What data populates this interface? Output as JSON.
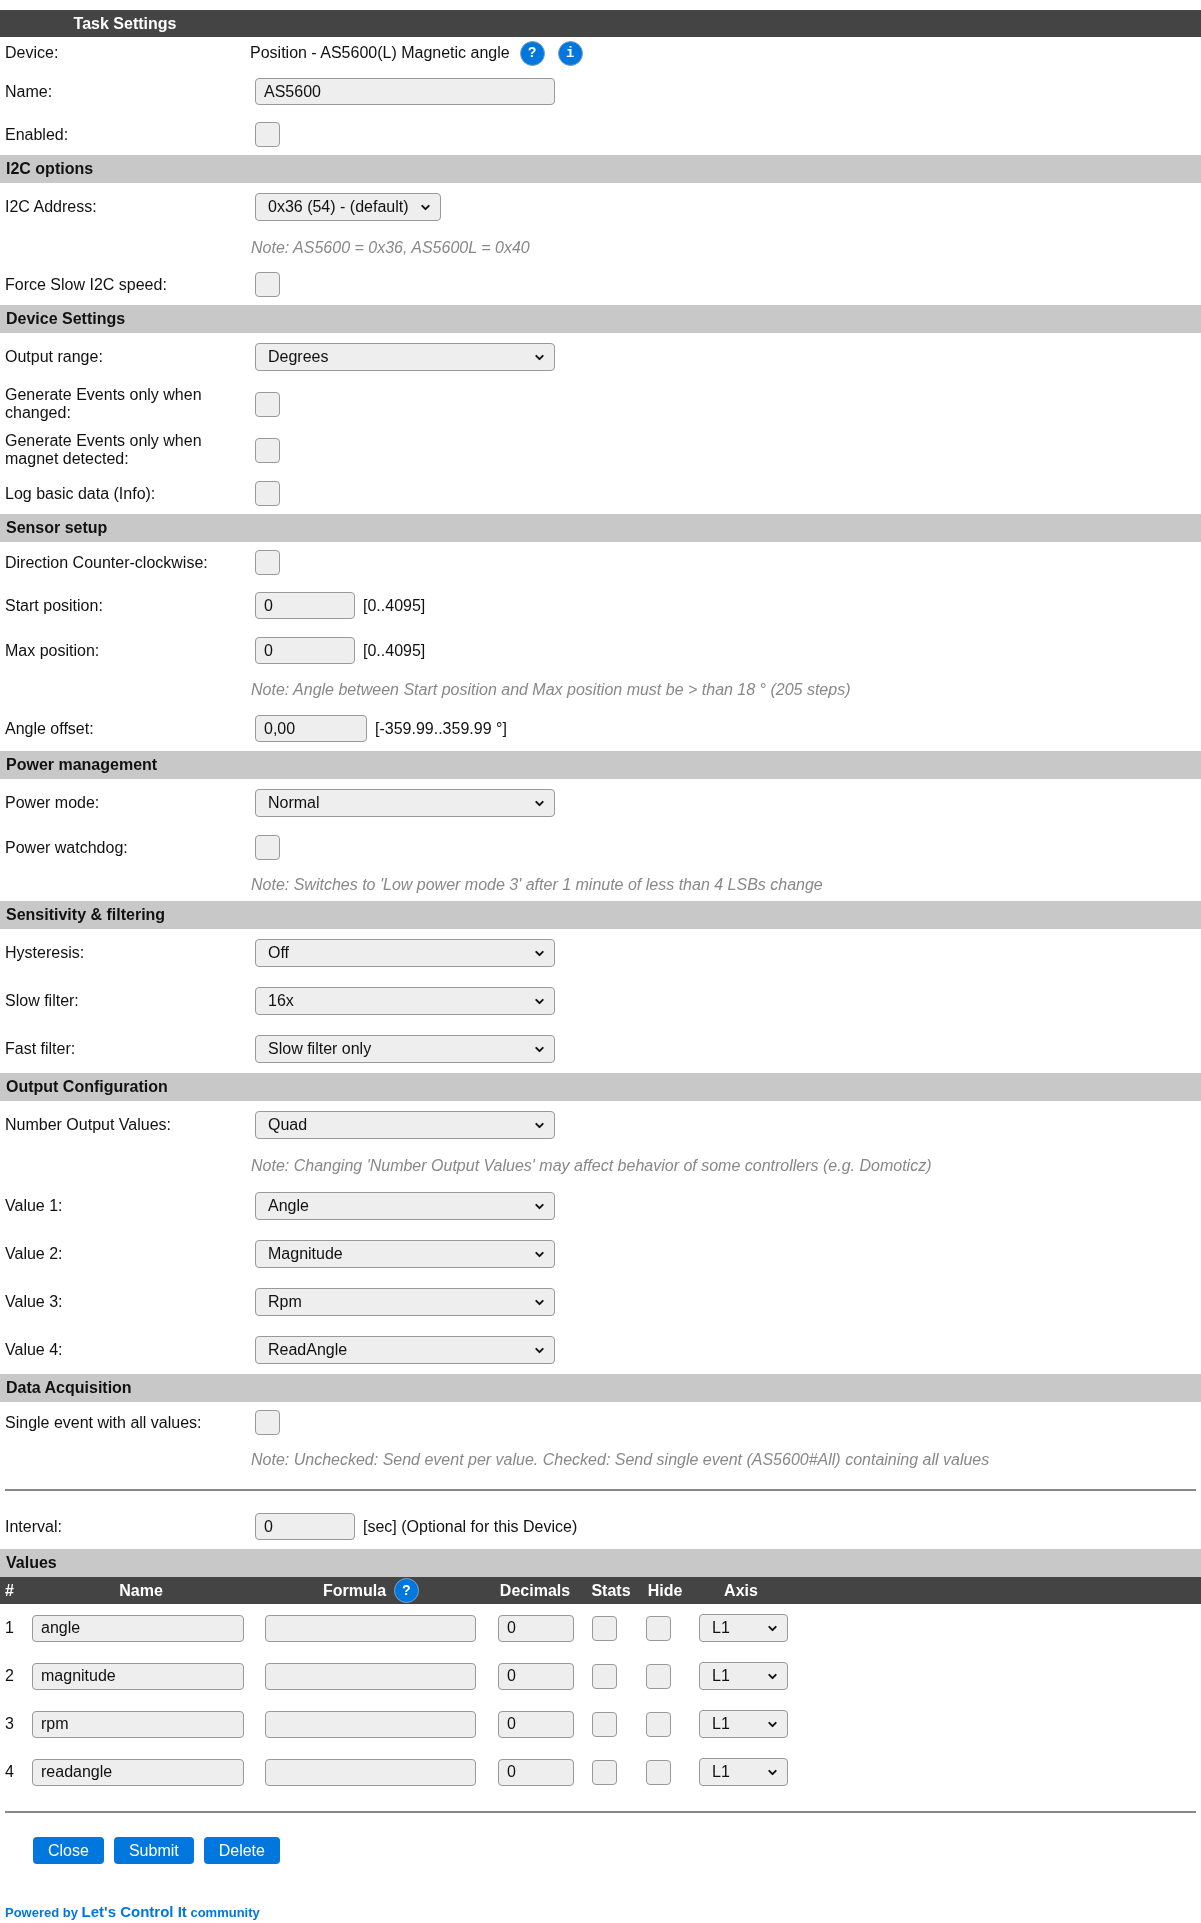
{
  "title": "Task Settings",
  "general": [
    {
      "kind": "device",
      "label": "Device:",
      "value": "Position - AS5600(L) Magnetic angle",
      "help": "?",
      "info": "i"
    },
    {
      "kind": "text",
      "label": "Name:",
      "value": "AS5600"
    },
    {
      "kind": "checkbox",
      "label": "Enabled:",
      "checked": false
    }
  ],
  "sections": [
    {
      "heading": "I2C options",
      "rows": [
        {
          "kind": "select_short",
          "label": "I2C Address:",
          "value": "0x36 (54) - (default)"
        },
        {
          "kind": "note",
          "text": "Note: AS5600 = 0x36, AS5600L = 0x40"
        },
        {
          "kind": "checkbox",
          "label": "Force Slow I2C speed:",
          "checked": false
        }
      ]
    },
    {
      "heading": "Device Settings",
      "rows": [
        {
          "kind": "select",
          "label": "Output range:",
          "value": "Degrees"
        },
        {
          "kind": "checkbox",
          "label": "Generate Events only when changed:",
          "checked": false
        },
        {
          "kind": "checkbox",
          "label": "Generate Events only when magnet detected:",
          "checked": false
        },
        {
          "kind": "checkbox",
          "label": "Log basic data (Info):",
          "checked": false
        }
      ]
    },
    {
      "heading": "Sensor setup",
      "rows": [
        {
          "kind": "checkbox",
          "label": "Direction Counter-clockwise:",
          "checked": false
        },
        {
          "kind": "number",
          "label": "Start position:",
          "value": "0",
          "hint": "[0..4095]"
        },
        {
          "kind": "number",
          "label": "Max position:",
          "value": "0",
          "hint": "[0..4095]"
        },
        {
          "kind": "note",
          "text": "Note: Angle between Start position and Max position must be > than 18 ° (205 steps)"
        },
        {
          "kind": "float",
          "label": "Angle offset:",
          "value": "0,00",
          "hint": "[-359.99..359.99 °]"
        }
      ]
    },
    {
      "heading": "Power management",
      "rows": [
        {
          "kind": "select",
          "label": "Power mode:",
          "value": "Normal"
        },
        {
          "kind": "checkbox",
          "label": "Power watchdog:",
          "checked": false
        },
        {
          "kind": "note",
          "text": "Note: Switches to 'Low power mode 3' after 1 minute of less than 4 LSBs change"
        }
      ]
    },
    {
      "heading": "Sensitivity & filtering",
      "rows": [
        {
          "kind": "select",
          "label": "Hysteresis:",
          "value": "Off"
        },
        {
          "kind": "select",
          "label": "Slow filter:",
          "value": "16x"
        },
        {
          "kind": "select",
          "label": "Fast filter:",
          "value": "Slow filter only"
        }
      ]
    },
    {
      "heading": "Output Configuration",
      "rows": [
        {
          "kind": "select",
          "label": "Number Output Values:",
          "value": "Quad"
        },
        {
          "kind": "note",
          "text": "Note: Changing 'Number Output Values' may affect behavior of some controllers (e.g. Domoticz)"
        },
        {
          "kind": "select",
          "label": "Value 1:",
          "value": "Angle"
        },
        {
          "kind": "select",
          "label": "Value 2:",
          "value": "Magnitude"
        },
        {
          "kind": "select",
          "label": "Value 3:",
          "value": "Rpm"
        },
        {
          "kind": "select",
          "label": "Value 4:",
          "value": "ReadAngle"
        }
      ]
    },
    {
      "heading": "Data Acquisition",
      "rows": [
        {
          "kind": "checkbox",
          "label": "Single event with all values:",
          "checked": false
        },
        {
          "kind": "note",
          "text": "Note: Unchecked: Send event per value. Checked: Send single event (AS5600#All) containing all values"
        }
      ]
    }
  ],
  "interval": {
    "kind": "number",
    "label": "Interval:",
    "value": "0",
    "hint": "[sec] (Optional for this Device)"
  },
  "values": {
    "heading": "Values",
    "columns": [
      {
        "label": "#"
      },
      {
        "label": "Name"
      },
      {
        "label": "Formula",
        "help": "?"
      },
      {
        "label": "Decimals"
      },
      {
        "label": "Stats"
      },
      {
        "label": "Hide"
      },
      {
        "label": "Axis"
      }
    ],
    "rows": [
      {
        "index": "1",
        "name": "angle",
        "decimals": "0",
        "stats": false,
        "hide": false,
        "axis": "L1"
      },
      {
        "index": "2",
        "name": "magnitude",
        "decimals": "0",
        "stats": false,
        "hide": false,
        "axis": "L1"
      },
      {
        "index": "3",
        "name": "rpm",
        "decimals": "0",
        "stats": false,
        "hide": false,
        "axis": "L1"
      },
      {
        "index": "4",
        "name": "readangle",
        "decimals": "0",
        "stats": false,
        "hide": false,
        "axis": "L1"
      }
    ]
  },
  "buttons": [
    "Close",
    "Submit",
    "Delete"
  ],
  "footer": {
    "prefix": "Powered by",
    "link": "Let's Control It",
    "suffix": "community"
  }
}
